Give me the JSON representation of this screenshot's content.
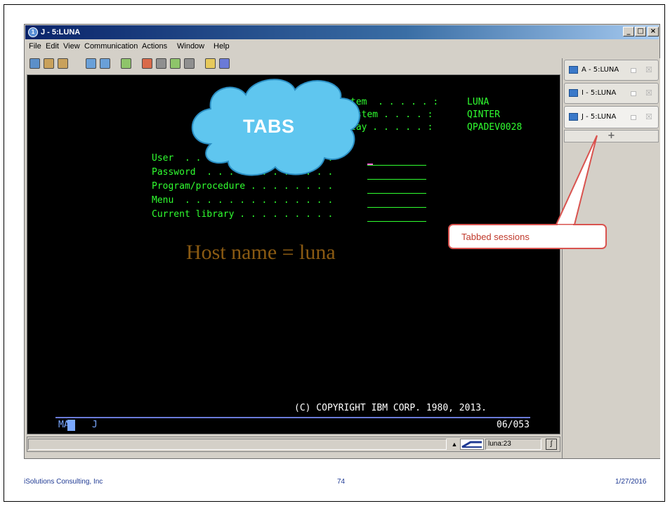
{
  "window": {
    "title": "J - 5:LUNA",
    "title_icon_glyph": "1",
    "minimize_glyph": "_",
    "maximize_glyph": "□",
    "close_glyph": "×"
  },
  "menu": [
    "File",
    "Edit",
    "View",
    "Communication",
    "Actions",
    "Window",
    "Help"
  ],
  "toolbar_icons": [
    {
      "name": "copy-icon",
      "color": "#5b8fc9"
    },
    {
      "name": "paste-icon",
      "color": "#c9a15b"
    },
    {
      "name": "paste-special-icon",
      "color": "#c9a15b"
    },
    {
      "name": "keyboard-icon",
      "color": "#6aa0d8"
    },
    {
      "name": "display-icon",
      "color": "#6aa0d8"
    },
    {
      "name": "macro-icon",
      "color": "#8ec46a"
    },
    {
      "name": "record-icon",
      "color": "#d96a4a"
    },
    {
      "name": "stop-icon",
      "color": "#8f8f8f"
    },
    {
      "name": "play-icon",
      "color": "#8ec46a"
    },
    {
      "name": "pause-icon",
      "color": "#8f8f8f"
    },
    {
      "name": "document-icon",
      "color": "#e6c95b"
    },
    {
      "name": "help-icon",
      "color": "#6a7ad8"
    }
  ],
  "terminal": {
    "system_row": {
      "label": "tem  . . . . . :",
      "value": "LUNA"
    },
    "subsystem_row": {
      "label": "ystem . . . . :",
      "value": "QINTER"
    },
    "display_row": {
      "label": "lay . . . . . :",
      "value": "QPADEV0028"
    },
    "fields": [
      {
        "label": "User  . . . . . . . . . . . . . ."
      },
      {
        "label": "Password  . . . . . . . . . . . ."
      },
      {
        "label": "Program/procedure . . . . . . . ."
      },
      {
        "label": "Menu  . . . . . . . . . . . . . ."
      },
      {
        "label": "Current library . . . . . . . . ."
      }
    ],
    "host_note": "Host name = luna",
    "copyright": "(C) COPYRIGHT IBM CORP. 1980, 2013.",
    "status_left": "MA",
    "status_code": "J",
    "cursor_pos": "06/053"
  },
  "statusbar": {
    "arrow": "▲",
    "host": "luna:23",
    "lock_glyph": "ʃ"
  },
  "tabs": [
    {
      "label": "A - 5:LUNA",
      "close": "☒",
      "active": false
    },
    {
      "label": "I - 5:LUNA",
      "close": "☒",
      "active": false
    },
    {
      "label": "J - 5:LUNA",
      "close": "☒",
      "active": true
    }
  ],
  "add_tab": "+",
  "annotations": {
    "cloud": "TABS",
    "callout": "Tabbed sessions"
  },
  "footer": {
    "company": "iSolutions Consulting, Inc",
    "page": "74",
    "date": "1/27/2016"
  }
}
